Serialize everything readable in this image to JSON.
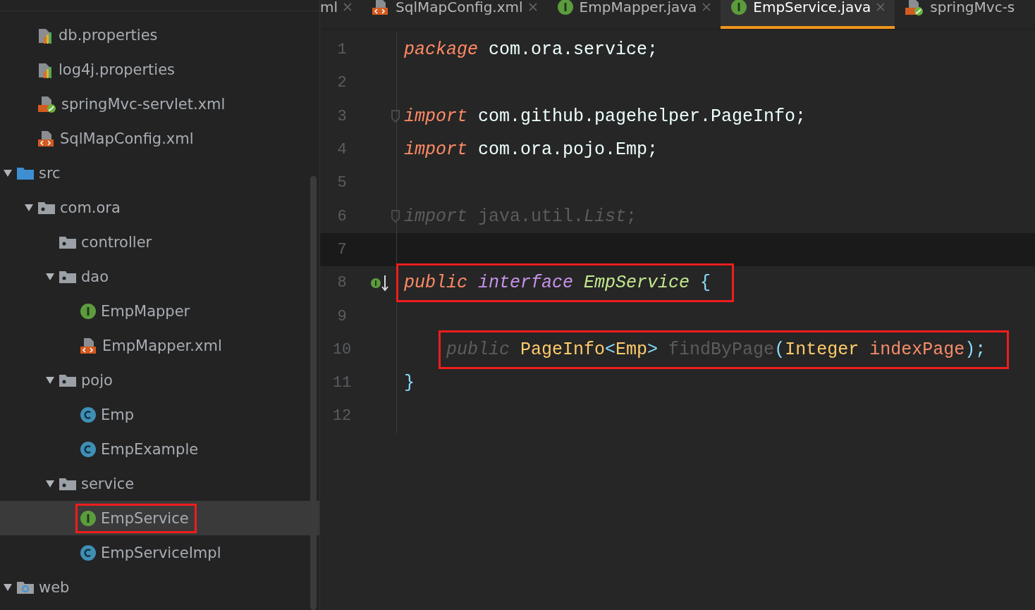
{
  "tree_clipped_items": [
    {
      "label": "db.properties",
      "kind": "properties",
      "selected": false,
      "highlighted": false
    },
    {
      "label": "log4j.properties",
      "kind": "properties",
      "selected": false,
      "highlighted": false
    },
    {
      "label": "springMvc-servlet.xml",
      "kind": "spring-xml",
      "selected": false,
      "highlighted": false
    },
    {
      "label": "SqlMapConfig.xml",
      "kind": "xml",
      "selected": false,
      "highlighted": false
    }
  ],
  "tree": [
    {
      "label": "src",
      "kind": "source-folder",
      "expanded": true,
      "selected": false,
      "highlighted": false,
      "children": [
        {
          "label": "com.ora",
          "kind": "package",
          "expanded": true,
          "selected": false,
          "highlighted": false,
          "children": [
            {
              "label": "controller",
              "kind": "package",
              "selected": false,
              "highlighted": false
            },
            {
              "label": "dao",
              "kind": "package",
              "expanded": true,
              "selected": false,
              "highlighted": false,
              "children": [
                {
                  "label": "EmpMapper",
                  "kind": "interface",
                  "selected": false,
                  "highlighted": false
                },
                {
                  "label": "EmpMapper.xml",
                  "kind": "xml",
                  "selected": false,
                  "highlighted": false
                }
              ]
            },
            {
              "label": "pojo",
              "kind": "package",
              "expanded": true,
              "selected": false,
              "highlighted": false,
              "children": [
                {
                  "label": "Emp",
                  "kind": "class",
                  "selected": false,
                  "highlighted": false
                },
                {
                  "label": "EmpExample",
                  "kind": "class",
                  "selected": false,
                  "highlighted": false
                }
              ]
            },
            {
              "label": "service",
              "kind": "package",
              "expanded": true,
              "selected": false,
              "highlighted": false,
              "children": [
                {
                  "label": "EmpService",
                  "kind": "interface",
                  "selected": true,
                  "highlighted": true
                },
                {
                  "label": "EmpServiceImpl",
                  "kind": "class",
                  "selected": false,
                  "highlighted": false
                }
              ]
            }
          ]
        }
      ]
    },
    {
      "label": "web",
      "kind": "web-folder",
      "expanded": true,
      "selected": false,
      "highlighted": false
    }
  ],
  "tabs": [
    {
      "label": "ml",
      "kind": "plain",
      "selected": false
    },
    {
      "label": "SqlMapConfig.xml",
      "kind": "xml",
      "selected": false
    },
    {
      "label": "EmpMapper.java",
      "kind": "interface",
      "selected": false
    },
    {
      "label": "EmpService.java",
      "kind": "interface",
      "selected": true
    },
    {
      "label": "springMvc-s",
      "kind": "spring-xml",
      "selected": false
    }
  ],
  "code_lines": [
    {
      "number": "1",
      "kind": "top-level",
      "current": false,
      "highlighted": false,
      "fold": false,
      "gutter_icon": false,
      "tokens": [
        {
          "kind": "keyword",
          "text": "package"
        },
        {
          "kind": "plain",
          "text": " com.ora.service;"
        }
      ]
    },
    {
      "number": "2",
      "kind": "top-level",
      "current": false,
      "highlighted": false,
      "fold": false,
      "gutter_icon": false
    },
    {
      "number": "3",
      "kind": "top-level",
      "current": false,
      "highlighted": false,
      "fold": true,
      "gutter_icon": false,
      "tokens": [
        {
          "kind": "keyword",
          "text": "import"
        },
        {
          "kind": "plain",
          "text": " com.github.pagehelper.PageInfo;"
        }
      ]
    },
    {
      "number": "4",
      "kind": "top-level",
      "current": false,
      "highlighted": false,
      "fold": false,
      "gutter_icon": false,
      "tokens": [
        {
          "kind": "keyword",
          "text": "import"
        },
        {
          "kind": "plain",
          "text": " com.ora.pojo.Emp;"
        }
      ]
    },
    {
      "number": "5",
      "kind": "top-level",
      "current": false,
      "highlighted": false,
      "fold": false,
      "gutter_icon": false
    },
    {
      "number": "6",
      "kind": "top-level",
      "current": false,
      "highlighted": false,
      "fold": true,
      "gutter_icon": false,
      "tokens": [
        {
          "kind": "unused-italic",
          "text": "import"
        },
        {
          "kind": "unused",
          "text": " java.util."
        },
        {
          "kind": "unused-italic",
          "text": "List"
        },
        {
          "kind": "unused",
          "text": ";"
        }
      ]
    },
    {
      "number": "7",
      "kind": "top-level",
      "current": true,
      "highlighted": false,
      "fold": false,
      "gutter_icon": false
    },
    {
      "number": "8",
      "kind": "top-level",
      "current": false,
      "highlighted": true,
      "fold": false,
      "gutter_icon": true,
      "tokens": [
        {
          "kind": "keyword",
          "text": "public"
        },
        {
          "kind": "keyword-purple",
          "text": " interface"
        },
        {
          "kind": "type-name",
          "text": " EmpService"
        },
        {
          "kind": "brace",
          "text": " {"
        }
      ]
    },
    {
      "number": "9",
      "kind": "top-level",
      "current": false,
      "highlighted": false,
      "fold": false,
      "gutter_icon": false
    },
    {
      "number": "10",
      "kind": "indented",
      "current": false,
      "highlighted": true,
      "fold": false,
      "gutter_icon": false,
      "tokens": [
        {
          "kind": "unused-italic",
          "text": "public"
        },
        {
          "kind": "type",
          "text": " PageInfo"
        },
        {
          "kind": "brace",
          "text": "<"
        },
        {
          "kind": "type",
          "text": "Emp"
        },
        {
          "kind": "brace",
          "text": ">"
        },
        {
          "kind": "unused",
          "text": " findByPage"
        },
        {
          "kind": "brace",
          "text": "("
        },
        {
          "kind": "type",
          "text": "Integer"
        },
        {
          "kind": "param",
          "text": " indexPage"
        },
        {
          "kind": "brace",
          "text": ");"
        }
      ]
    },
    {
      "number": "11",
      "kind": "top-level",
      "current": false,
      "highlighted": false,
      "fold": false,
      "gutter_icon": false,
      "tokens": [
        {
          "kind": "brace",
          "text": "}"
        }
      ]
    },
    {
      "number": "12",
      "kind": "top-level",
      "current": false,
      "highlighted": false,
      "fold": false,
      "gutter_icon": false
    }
  ]
}
